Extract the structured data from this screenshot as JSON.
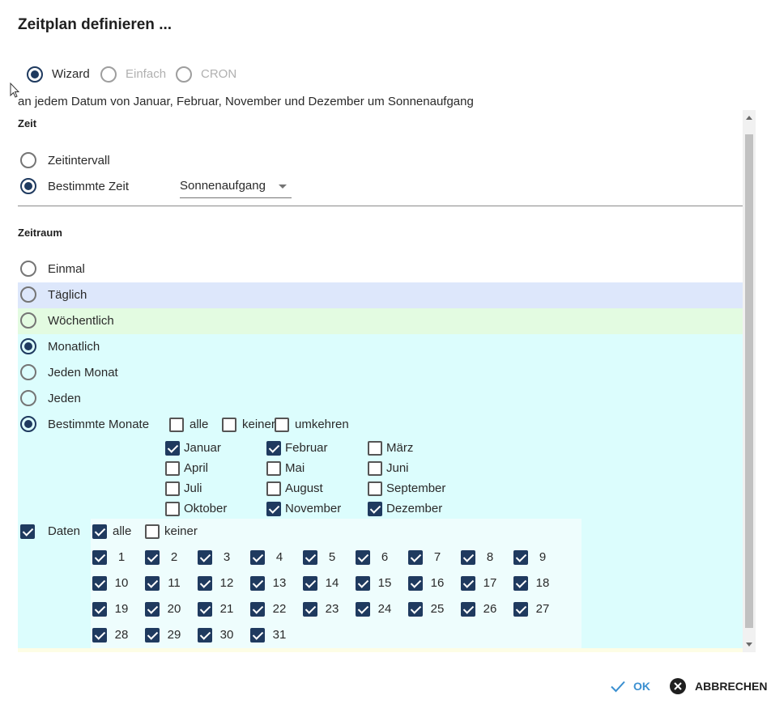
{
  "dialog": {
    "title": "Zeitplan definieren ...",
    "summary": "an jedem Datum von Januar, Februar, November und Dezember um Sonnenaufgang"
  },
  "mode": {
    "options": [
      {
        "label": "Wizard",
        "selected": true,
        "disabled": false
      },
      {
        "label": "Einfach",
        "selected": false,
        "disabled": true
      },
      {
        "label": "CRON",
        "selected": false,
        "disabled": true
      }
    ]
  },
  "time": {
    "section_label": "Zeit",
    "interval_label": "Zeitintervall",
    "specific_label": "Bestimmte Zeit",
    "selected": "specific",
    "select_value": "Sonnenaufgang"
  },
  "period": {
    "section_label": "Zeitraum",
    "once": "Einmal",
    "daily": "Täglich",
    "weekly": "Wöchentlich",
    "monthly": "Monatlich",
    "every_month": "Jeden Monat",
    "every": "Jeden",
    "specific_months": "Bestimmte Monate",
    "selected": "monthly"
  },
  "months": {
    "all": "alle",
    "none": "keiner",
    "invert": "umkehren",
    "list": [
      {
        "label": "Januar",
        "checked": true
      },
      {
        "label": "Februar",
        "checked": true
      },
      {
        "label": "März",
        "checked": false
      },
      {
        "label": "April",
        "checked": false
      },
      {
        "label": "Mai",
        "checked": false
      },
      {
        "label": "Juni",
        "checked": false
      },
      {
        "label": "Juli",
        "checked": false
      },
      {
        "label": "August",
        "checked": false
      },
      {
        "label": "September",
        "checked": false
      },
      {
        "label": "Oktober",
        "checked": false
      },
      {
        "label": "November",
        "checked": true
      },
      {
        "label": "Dezember",
        "checked": true
      }
    ]
  },
  "dates": {
    "label": "Daten",
    "checked": true,
    "all": "alle",
    "all_checked": true,
    "none": "keiner",
    "none_checked": false,
    "days": [
      "1",
      "2",
      "3",
      "4",
      "5",
      "6",
      "7",
      "8",
      "9",
      "10",
      "11",
      "12",
      "13",
      "14",
      "15",
      "16",
      "17",
      "18",
      "19",
      "20",
      "21",
      "22",
      "23",
      "24",
      "25",
      "26",
      "27",
      "28",
      "29",
      "30",
      "31"
    ]
  },
  "buttons": {
    "ok": "OK",
    "cancel": "ABBRECHEN"
  },
  "colors": {
    "accent": "#1f3a5f",
    "ok_text": "#3a8fd0",
    "band_daily": "#dde7fb",
    "band_weekly": "#e3fbe1",
    "band_monthly": "#dcfdfd"
  }
}
